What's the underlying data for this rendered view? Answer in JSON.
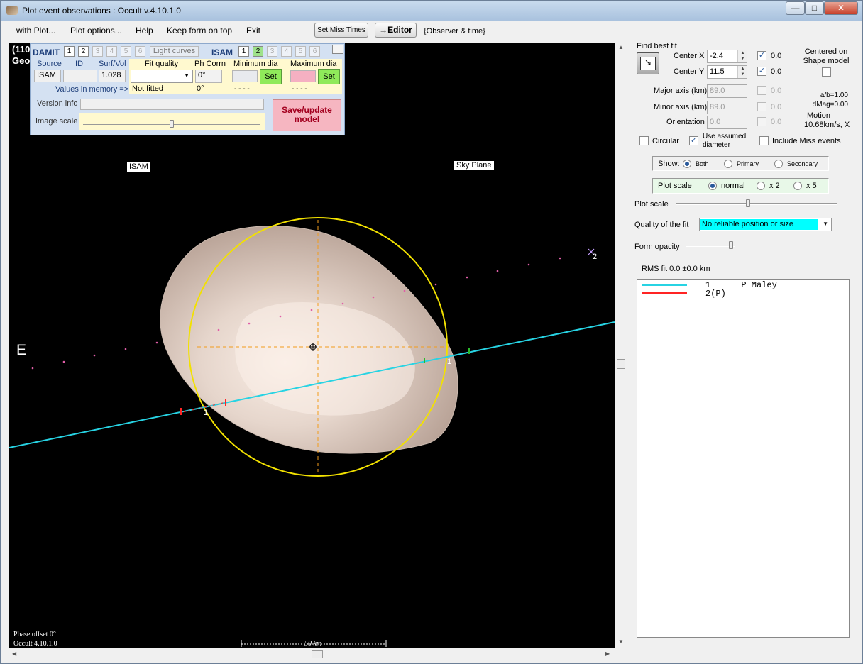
{
  "window": {
    "title": "Plot event observations : Occult v.4.10.1.0"
  },
  "menu": {
    "items": [
      "with Plot...",
      "Plot options...",
      "Help",
      "Keep form on top",
      "Exit"
    ],
    "set_miss_times": "Set Miss Times",
    "editor": "→Editor",
    "observer_time": "{Observer & time}"
  },
  "plot": {
    "corner_title_1": "(110",
    "corner_title_2": "Geo",
    "isam_label": "ISAM",
    "sky_plane_label": "Sky Plane",
    "east_label": "E",
    "chord_1_label": "1",
    "chord_2_label": "2",
    "chord_2_start_label": "1",
    "phase_offset": "Phase offset 0°",
    "version": "Occult 4.10.1.0",
    "scale_label": "50 km",
    "colors": {
      "shape": "#e6d6cc",
      "fit_ellipse": "#f2e100",
      "chord_1": "#27d3e3",
      "chord_2": "#ff2424",
      "axes": "#f29c1c"
    }
  },
  "shape_panel": {
    "damit_label": "DAMIT",
    "damit_models": [
      "1",
      "2",
      "3",
      "4",
      "5",
      "6"
    ],
    "light_curves": "Light curves",
    "isam_label": "ISAM",
    "isam_models": [
      "1",
      "2",
      "3",
      "4",
      "5",
      "6"
    ],
    "headers": {
      "source": "Source",
      "id": "ID",
      "surf_vol": "Surf/Vol",
      "fit_quality": "Fit quality",
      "ph_corrn": "Ph Corrn",
      "min_dia": "Minimum dia",
      "max_dia": "Maximum dia"
    },
    "source_value": "ISAM",
    "surf_vol_value": "1.028",
    "ph_corrn_value": "0°",
    "set_label": "Set",
    "values_in_memory": "Values in memory =>",
    "not_fitted": "Not fitted",
    "memory_ph_corrn": "0°",
    "memory_min": "- - - -",
    "memory_max": "- - - -",
    "version_info_label": "Version info",
    "image_scale_label": "Image scale",
    "save_update": "Save/update model"
  },
  "fit_panel": {
    "find_best_fit": "Find best fit",
    "center_x_label": "Center X",
    "center_x_value": "-2.4",
    "center_x_delta": "0.0",
    "center_y_label": "Center Y",
    "center_y_value": "11.5",
    "center_y_delta": "0.0",
    "centered_on_shape": "Centered on Shape model",
    "major_axis_label": "Major axis (km)",
    "major_axis_value": "89.0",
    "major_delta": "0.0",
    "minor_axis_label": "Minor axis (km)",
    "minor_axis_value": "89.0",
    "minor_delta": "0.0",
    "orientation_label": "Orientation",
    "orientation_value": "0.0",
    "orientation_delta": "0.0",
    "ab_ratio": "a/b=1.00",
    "dmag": "dMag=0.00",
    "motion": "Motion",
    "motion_value": "10.68km/s, X",
    "circular": "Circular",
    "use_assumed_diameter": "Use assumed diameter",
    "include_miss": "Include Miss events",
    "show_label": "Show:",
    "show_options": [
      "Both",
      "Primary",
      "Secondary"
    ],
    "plot_scale_group": "Plot scale",
    "plot_scale_options": [
      "normal",
      "x 2",
      "x 5"
    ],
    "plot_scale_slider": "Plot scale",
    "quality_label": "Quality of the fit",
    "quality_value": "No reliable position or size",
    "form_opacity": "Form opacity",
    "rms_fit": "RMS fit 0.0 ±0.0 km",
    "legend": [
      {
        "text": "1      P Maley",
        "color": "#27d3e3"
      },
      {
        "text": "2(P)",
        "color": "#ff2424"
      }
    ]
  }
}
